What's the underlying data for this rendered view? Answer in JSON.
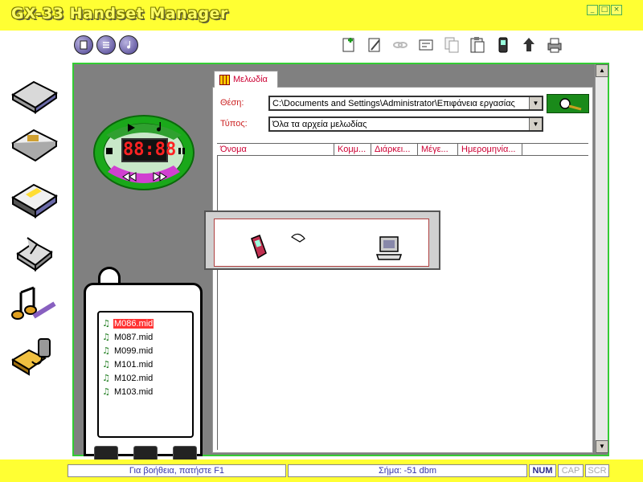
{
  "app": {
    "title": "GX-33 Handset Manager"
  },
  "window_controls": [
    "_",
    "□",
    "×"
  ],
  "toolbar_left": [
    {
      "name": "new-icon"
    },
    {
      "name": "list-icon"
    },
    {
      "name": "music-note-icon"
    }
  ],
  "toolbar_right": [
    {
      "name": "add-icon"
    },
    {
      "name": "edit-icon"
    },
    {
      "name": "link-icon"
    },
    {
      "name": "properties-icon"
    },
    {
      "name": "copy-icon"
    },
    {
      "name": "paste-icon"
    },
    {
      "name": "send-to-phone-icon"
    },
    {
      "name": "upload-icon"
    },
    {
      "name": "printer-icon"
    }
  ],
  "sidebar": [
    {
      "name": "sidebar-phonebook"
    },
    {
      "name": "sidebar-messages"
    },
    {
      "name": "sidebar-calendar"
    },
    {
      "name": "sidebar-settings"
    },
    {
      "name": "sidebar-melodies"
    },
    {
      "name": "sidebar-connection"
    }
  ],
  "player": {
    "display": "88:88"
  },
  "phone": {
    "files": [
      {
        "name": "M086.mid",
        "selected": true
      },
      {
        "name": "M087.mid",
        "selected": false
      },
      {
        "name": "M099.mid",
        "selected": false
      },
      {
        "name": "M101.mid",
        "selected": false
      },
      {
        "name": "M102.mid",
        "selected": false
      },
      {
        "name": "M103.mid",
        "selected": false
      }
    ]
  },
  "tab": {
    "label": "Μελωδία"
  },
  "location": {
    "label": "Θέση:",
    "value": "C:\\Documents and Settings\\Administrator\\Επιφάνεια εργασίας"
  },
  "type": {
    "label": "Τύπος:",
    "value": "Όλα τα αρχεία μελωδίας"
  },
  "columns": [
    "Όνομα",
    "Κομμ...",
    "Διάρκει...",
    "Μέγε...",
    "Ημερομηνία..."
  ],
  "status": {
    "help": "Για βοήθεια, πατήστε F1",
    "signal": "Σήμα: -51 dbm",
    "num": "NUM",
    "cap": "CAP",
    "scr": "SCR"
  },
  "colors": {
    "titlebar": "#ffff33",
    "panel": "#808080",
    "accent_green": "#33cc33"
  }
}
